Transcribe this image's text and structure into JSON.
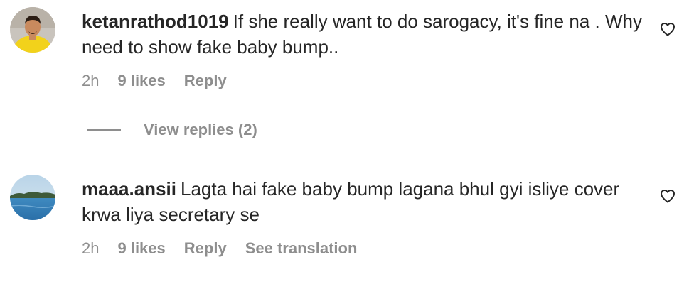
{
  "comments": [
    {
      "username": "ketanrathod1019",
      "text": "If she really want to do sarogacy, it's fine na . Why need to show fake baby bump..",
      "time": "2h",
      "likes": "9 likes",
      "reply_label": "Reply",
      "view_replies": "View replies (2)"
    },
    {
      "username": "maaa.ansii",
      "text": "Lagta hai fake baby bump lagana bhul gyi isliye cover krwa liya secretary se",
      "time": "2h",
      "likes": "9 likes",
      "reply_label": "Reply",
      "translation_label": "See translation"
    }
  ],
  "icons": {
    "like": "heart-outline-icon"
  },
  "colors": {
    "text": "#262626",
    "secondary": "#8e8e8e"
  }
}
